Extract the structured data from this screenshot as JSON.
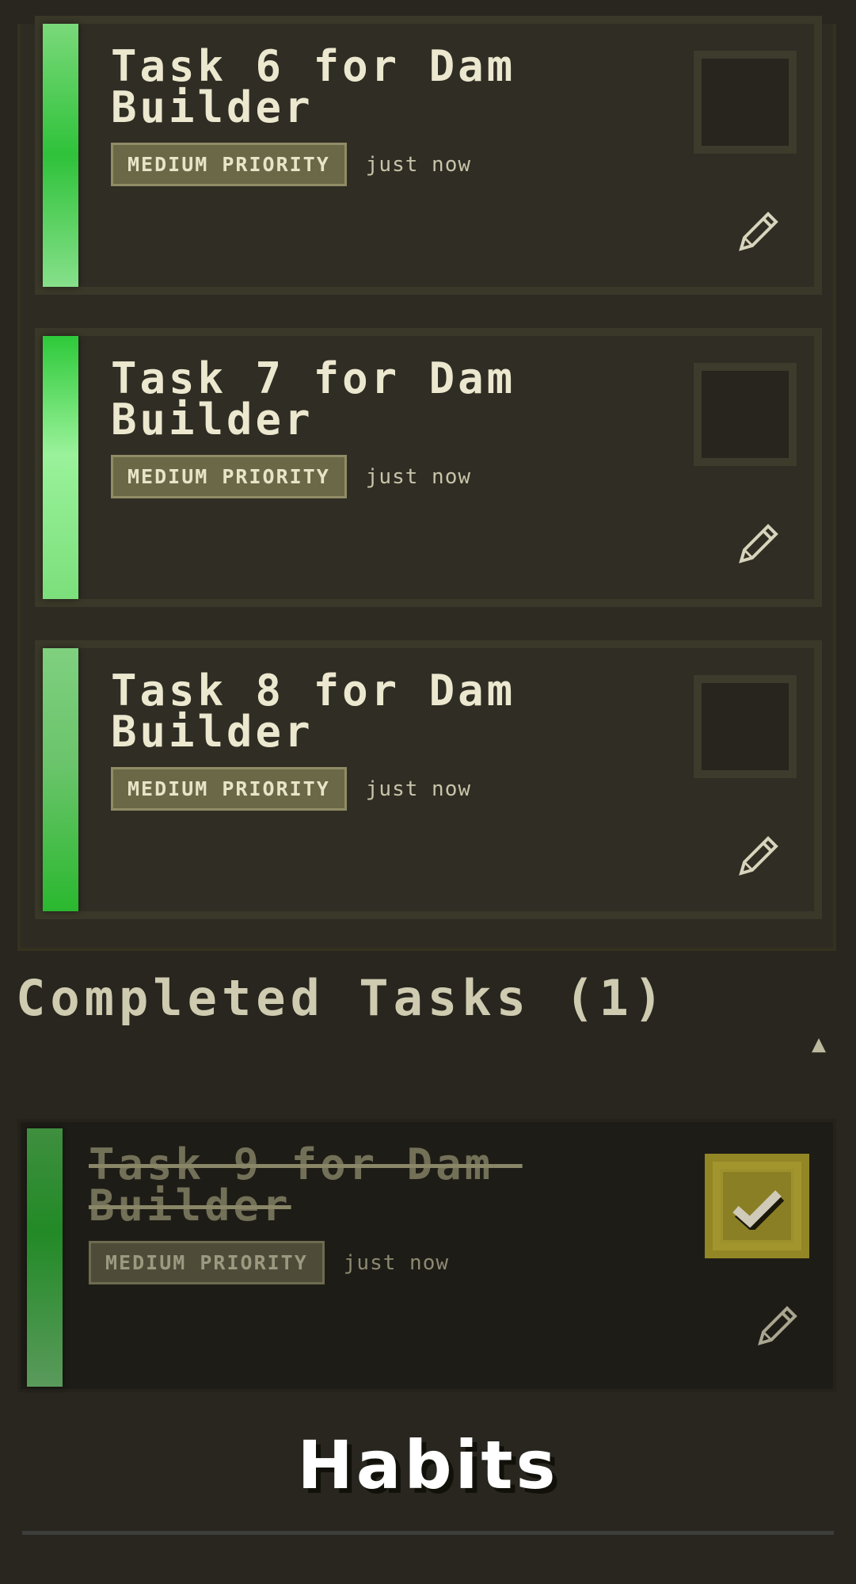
{
  "active_tasks": [
    {
      "title": "Task 6 for Dam Builder",
      "priority": "MEDIUM PRIORITY",
      "time": "just now"
    },
    {
      "title": "Task 7 for Dam Builder",
      "priority": "MEDIUM PRIORITY",
      "time": "just now"
    },
    {
      "title": "Task 8 for Dam Builder",
      "priority": "MEDIUM PRIORITY",
      "time": "just now"
    }
  ],
  "completed_section": {
    "title": "Completed Tasks (1)",
    "toggle_glyph": "▲"
  },
  "completed_tasks": [
    {
      "title": "Task 9 for Dam Builder",
      "priority": "MEDIUM PRIORITY",
      "time": "just now",
      "checked": true
    }
  ],
  "habits": {
    "title": "Habits"
  },
  "icons": {
    "edit": "pencil-icon",
    "check": "checkmark-icon"
  },
  "colors": {
    "background": "#28261f",
    "accent_green": "#2ec93a",
    "badge_bg": "#6b6847",
    "checked_box": "#a3952e"
  }
}
